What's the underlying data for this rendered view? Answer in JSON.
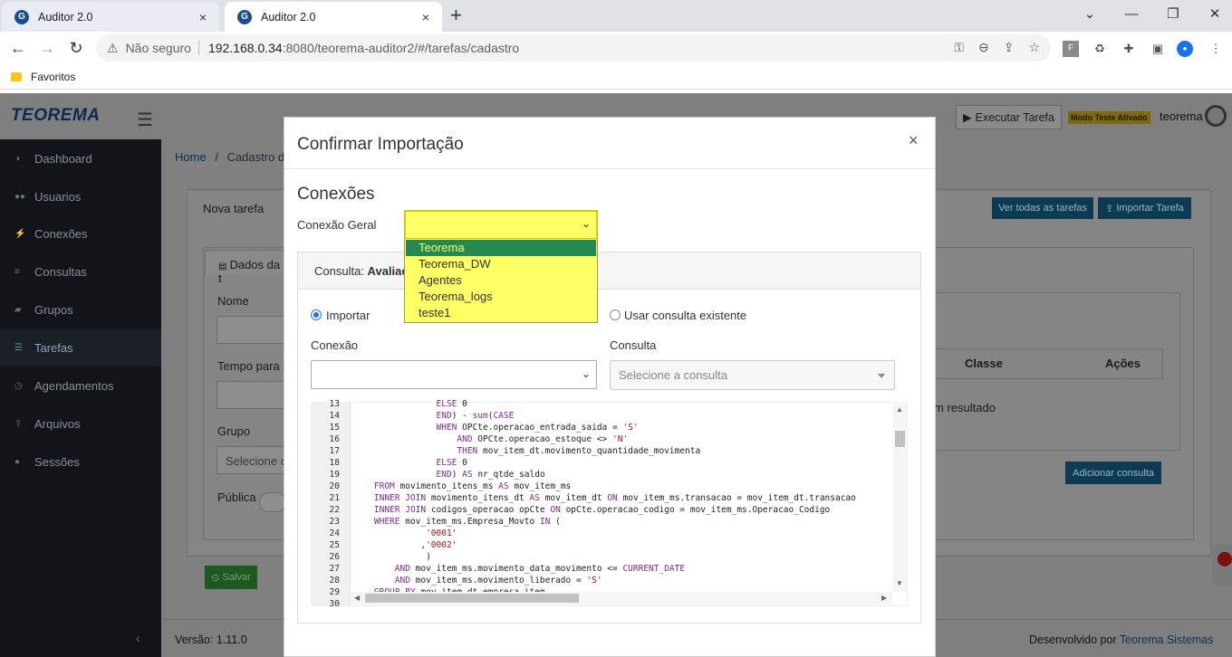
{
  "browser": {
    "tabs": [
      {
        "title": "Auditor 2.0",
        "close": "×"
      },
      {
        "title": "Auditor 2.0",
        "close": "×"
      }
    ],
    "new_tab": "+",
    "nav": {
      "back": "←",
      "forward": "→",
      "reload": "↻"
    },
    "security": "Não seguro",
    "url_host": "192.168.0.34",
    "url_rest": ":8080/teorema-auditor2/#/tarefas/cadastro",
    "bookmark": "Favoritos",
    "window": {
      "minimize": "⌄",
      "min": "—",
      "restore": "❐",
      "close": "✕"
    }
  },
  "app": {
    "logo": "TEOREMA",
    "header": {
      "execute_button": "Executar Tarefa",
      "test_mode_badge": "Modo Teste Ativado",
      "user": "teorema"
    },
    "sidebar": {
      "items": [
        {
          "label": "Dashboard",
          "icon": "dashboard-icon"
        },
        {
          "label": "Usuarios",
          "icon": "users-icon"
        },
        {
          "label": "Conexões",
          "icon": "plug-icon"
        },
        {
          "label": "Consultas",
          "icon": "database-icon"
        },
        {
          "label": "Grupos",
          "icon": "folder-icon"
        },
        {
          "label": "Tarefas",
          "icon": "list-icon"
        },
        {
          "label": "Agendamentos",
          "icon": "clock-icon"
        },
        {
          "label": "Arquivos",
          "icon": "upload-icon"
        },
        {
          "label": "Sessões",
          "icon": "user-icon"
        }
      ],
      "active_index": 5,
      "collapse": "‹"
    },
    "breadcrumb": {
      "home": "Home",
      "sep": "/",
      "current": "Cadastro de"
    },
    "panel": {
      "title": "Nova tarefa",
      "btn_all_tasks": "Ver todas as tarefas",
      "btn_import": "Importar Tarefa",
      "tab_dados": "Dados da t",
      "fields": {
        "name": "Nome",
        "time": "Tempo para a",
        "group": "Grupo",
        "group_placeholder": "Selecione o",
        "public": "Pública"
      },
      "table": {
        "col_class": "Classe",
        "col_actions": "Ações",
        "empty": "m resultado"
      },
      "btn_add_query": "Adicionar consulta",
      "btn_save": "Salvar"
    },
    "footer": {
      "version": "Versão: 1.11.0",
      "developed_by": "Desenvolvido por",
      "company": "Teorema Sistemas"
    }
  },
  "modal": {
    "title": "Confirmar Importação",
    "close": "×",
    "section": "Conexões",
    "general_connection_label": "Conexão Geral",
    "general_connection_options": [
      "Teorema",
      "Teorema_DW",
      "Agentes",
      "Teorema_logs",
      "teste1"
    ],
    "general_connection_highlighted": "Teorema",
    "query_label": "Consulta:",
    "query_name": "Avaliaçã",
    "radio_import": "Importar",
    "radio_use_existing": "Usar consulta existente",
    "radio_selected": "import",
    "connection_label": "Conexão",
    "connection_value": "",
    "query_select_label": "Consulta",
    "query_select_placeholder": "Selecione a consulta",
    "editor": {
      "line_numbers": [
        "13",
        "14",
        "15",
        "16",
        "17",
        "18",
        "19",
        "20",
        "21",
        "22",
        "23",
        "24",
        "25",
        "26",
        "27",
        "28",
        "29",
        "30"
      ],
      "lines": [
        "                ELSE 0",
        "                END) - sum(CASE",
        "                WHEN OPCte.operacao_entrada_saida = 'S'",
        "                    AND OPCte.operacao_estoque <> 'N'",
        "                    THEN mov_item_dt.movimento_quantidade_movimenta",
        "                ELSE 0",
        "                END) AS nr_qtde_saldo",
        "    FROM movimento_itens_ms AS mov_item_ms",
        "    INNER JOIN movimento_itens_dt AS mov_item_dt ON mov_item_ms.transacao = mov_item_dt.transacao",
        "    INNER JOIN codigos_operacao opCte ON opCte.operacao_codigo = mov_item_ms.Operacao_Codigo",
        "    WHERE mov_item_ms.Empresa_Movto IN (",
        "              '0001'",
        "             ,'0002'",
        "              )",
        "        AND mov_item_ms.movimento_data_movimento <= CURRENT_DATE",
        "        AND mov_item_ms.movimento_liberado = 'S'",
        "    GROUP BY mov_item_dt.empresa_item",
        ""
      ]
    }
  }
}
